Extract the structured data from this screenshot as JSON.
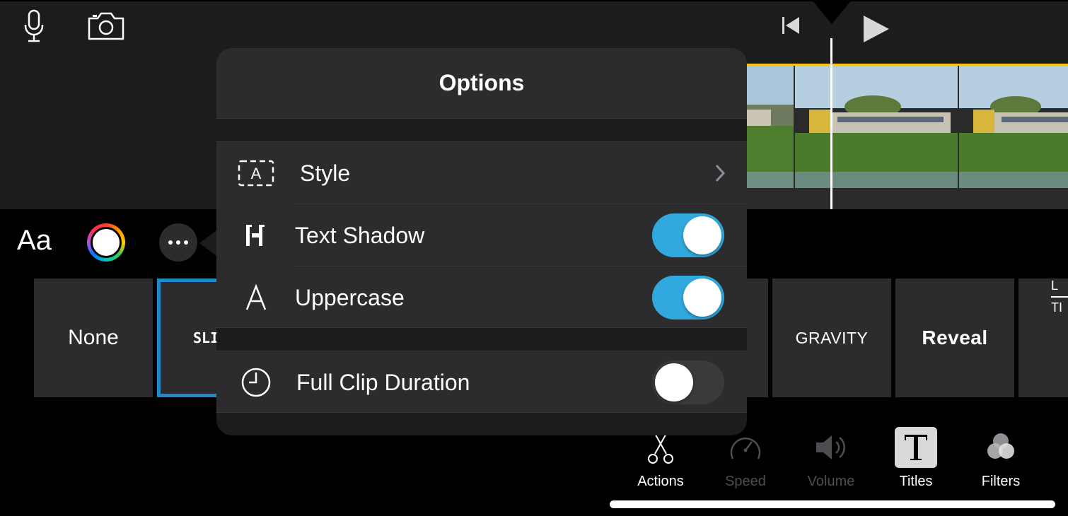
{
  "toolbar_top": {
    "icons": [
      "microphone-icon",
      "camera-icon",
      "skip-to-start-icon",
      "play-icon"
    ]
  },
  "title_tools": {
    "font_label": "Aa",
    "color_icon": "color-wheel-icon",
    "more_icon": "ellipsis-icon"
  },
  "title_styles": [
    {
      "label": "None"
    },
    {
      "label": "SLI",
      "selected": true
    },
    {
      "label": "GRAVITY"
    },
    {
      "label": "Reveal"
    },
    {
      "label": "L",
      "label2": "TI"
    }
  ],
  "options_popover": {
    "title": "Options",
    "rows": [
      {
        "label": "Style",
        "icon": "style-frame-icon",
        "chevron": true
      },
      {
        "label": "Text Shadow",
        "icon": "text-shadow-icon",
        "toggle": true
      },
      {
        "label": "Uppercase",
        "icon": "uppercase-a-icon",
        "toggle": true
      },
      {
        "label": "Full Clip Duration",
        "icon": "clock-icon",
        "toggle": false
      }
    ]
  },
  "bottom_tools": [
    {
      "label": "Actions",
      "icon": "scissors-icon",
      "state": "enabled"
    },
    {
      "label": "Speed",
      "icon": "speedometer-icon",
      "state": "disabled"
    },
    {
      "label": "Volume",
      "icon": "speaker-icon",
      "state": "disabled"
    },
    {
      "label": "Titles",
      "icon": "titles-t-icon",
      "state": "selected"
    },
    {
      "label": "Filters",
      "icon": "filters-circles-icon",
      "state": "enabled"
    }
  ],
  "colors": {
    "toggle_on": "#31a8de",
    "selection_border": "#1e88c8",
    "clip_border": "#f5c518"
  }
}
